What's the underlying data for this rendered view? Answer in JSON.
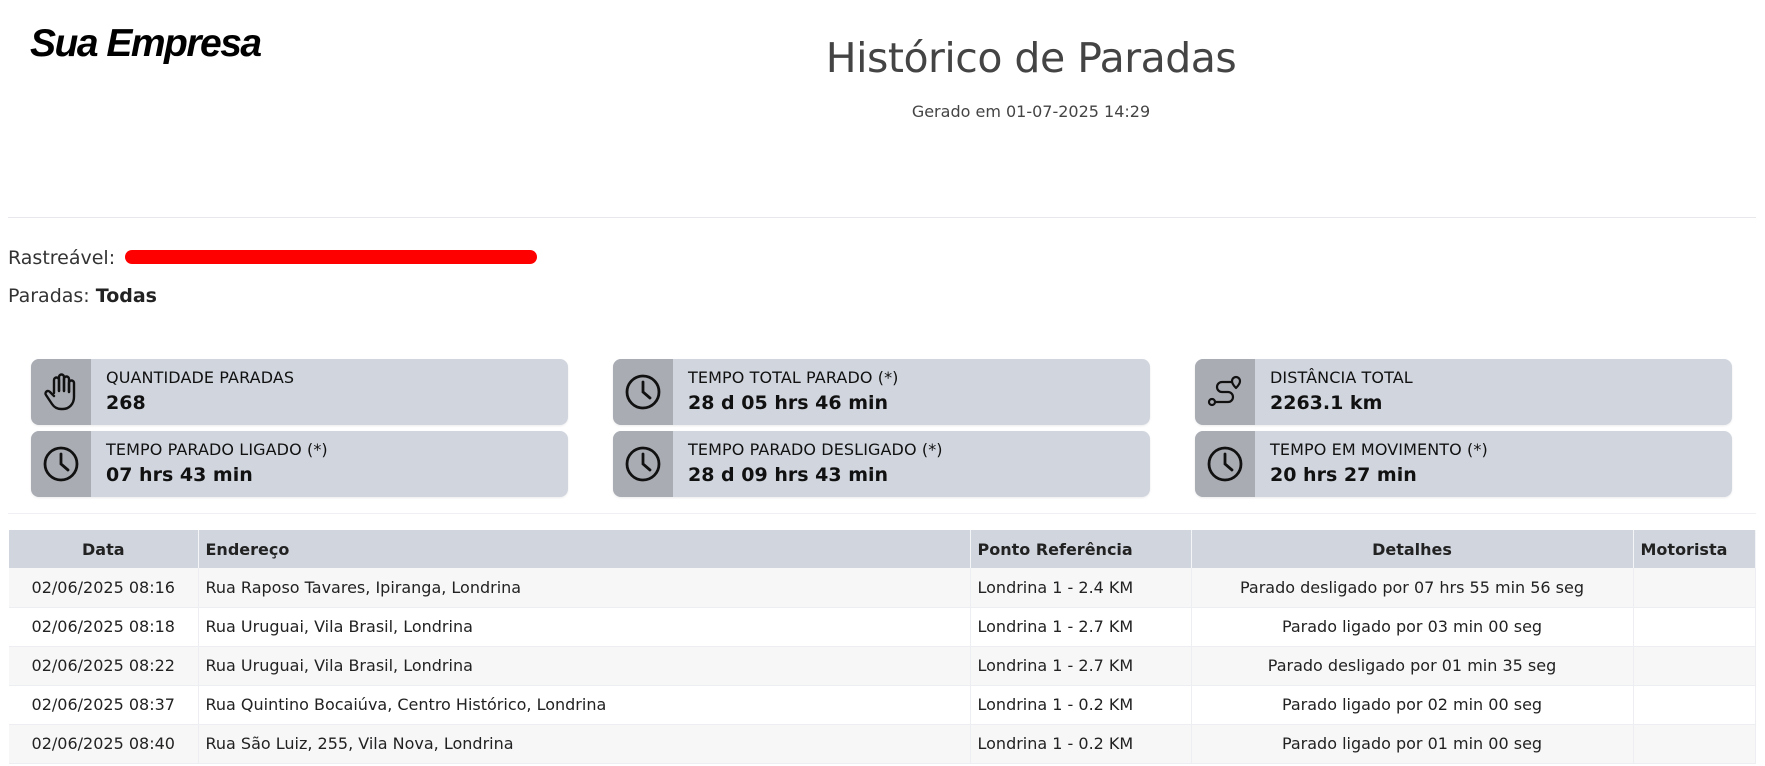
{
  "header": {
    "logo": "Sua Empresa",
    "title": "Histórico de Paradas",
    "generated": "Gerado em 01-07-2025 14:29"
  },
  "filters": {
    "trackable_label": "Rastreável:",
    "stops_label": "Paradas:",
    "stops_value": "Todas"
  },
  "cards": [
    {
      "icon": "hand-icon",
      "label": "QUANTIDADE PARADAS",
      "value": "268"
    },
    {
      "icon": "clock-icon",
      "label": "TEMPO TOTAL PARADO (*)",
      "value": "28 d 05 hrs 46 min"
    },
    {
      "icon": "route-icon",
      "label": "DISTÂNCIA TOTAL",
      "value": "2263.1 km"
    },
    {
      "icon": "clock-icon",
      "label": "TEMPO PARADO LIGADO (*)",
      "value": "07 hrs 43 min"
    },
    {
      "icon": "clock-icon",
      "label": "TEMPO PARADO DESLIGADO (*)",
      "value": "28 d 09 hrs 43 min"
    },
    {
      "icon": "clock-icon",
      "label": "TEMPO EM MOVIMENTO (*)",
      "value": "20 hrs 27 min"
    }
  ],
  "table": {
    "columns": [
      "Data",
      "Endereço",
      "Ponto Referência",
      "Detalhes",
      "Motorista"
    ],
    "rows": [
      {
        "date": "02/06/2025 08:16",
        "address": "Rua Raposo Tavares, Ipiranga, Londrina",
        "reference": "Londrina 1 - 2.4 KM",
        "details": "Parado desligado por 07 hrs 55 min 56 seg",
        "driver": ""
      },
      {
        "date": "02/06/2025 08:18",
        "address": "Rua Uruguai, Vila Brasil, Londrina",
        "reference": "Londrina 1 - 2.7 KM",
        "details": "Parado ligado por 03 min 00 seg",
        "driver": ""
      },
      {
        "date": "02/06/2025 08:22",
        "address": "Rua Uruguai, Vila Brasil, Londrina",
        "reference": "Londrina 1 - 2.7 KM",
        "details": "Parado desligado por 01 min 35 seg",
        "driver": ""
      },
      {
        "date": "02/06/2025 08:37",
        "address": "Rua Quintino Bocaiúva, Centro Histórico, Londrina",
        "reference": "Londrina 1 - 0.2 KM",
        "details": "Parado ligado por 02 min 00 seg",
        "driver": ""
      },
      {
        "date": "02/06/2025 08:40",
        "address": "Rua São Luiz, 255, Vila Nova, Londrina",
        "reference": "Londrina 1 - 0.2 KM",
        "details": "Parado ligado por 01 min 00 seg",
        "driver": ""
      }
    ]
  },
  "colors": {
    "card_bg": "#d0d5de",
    "icon_bg": "#a9acb3",
    "redaction": "#ff0000"
  }
}
